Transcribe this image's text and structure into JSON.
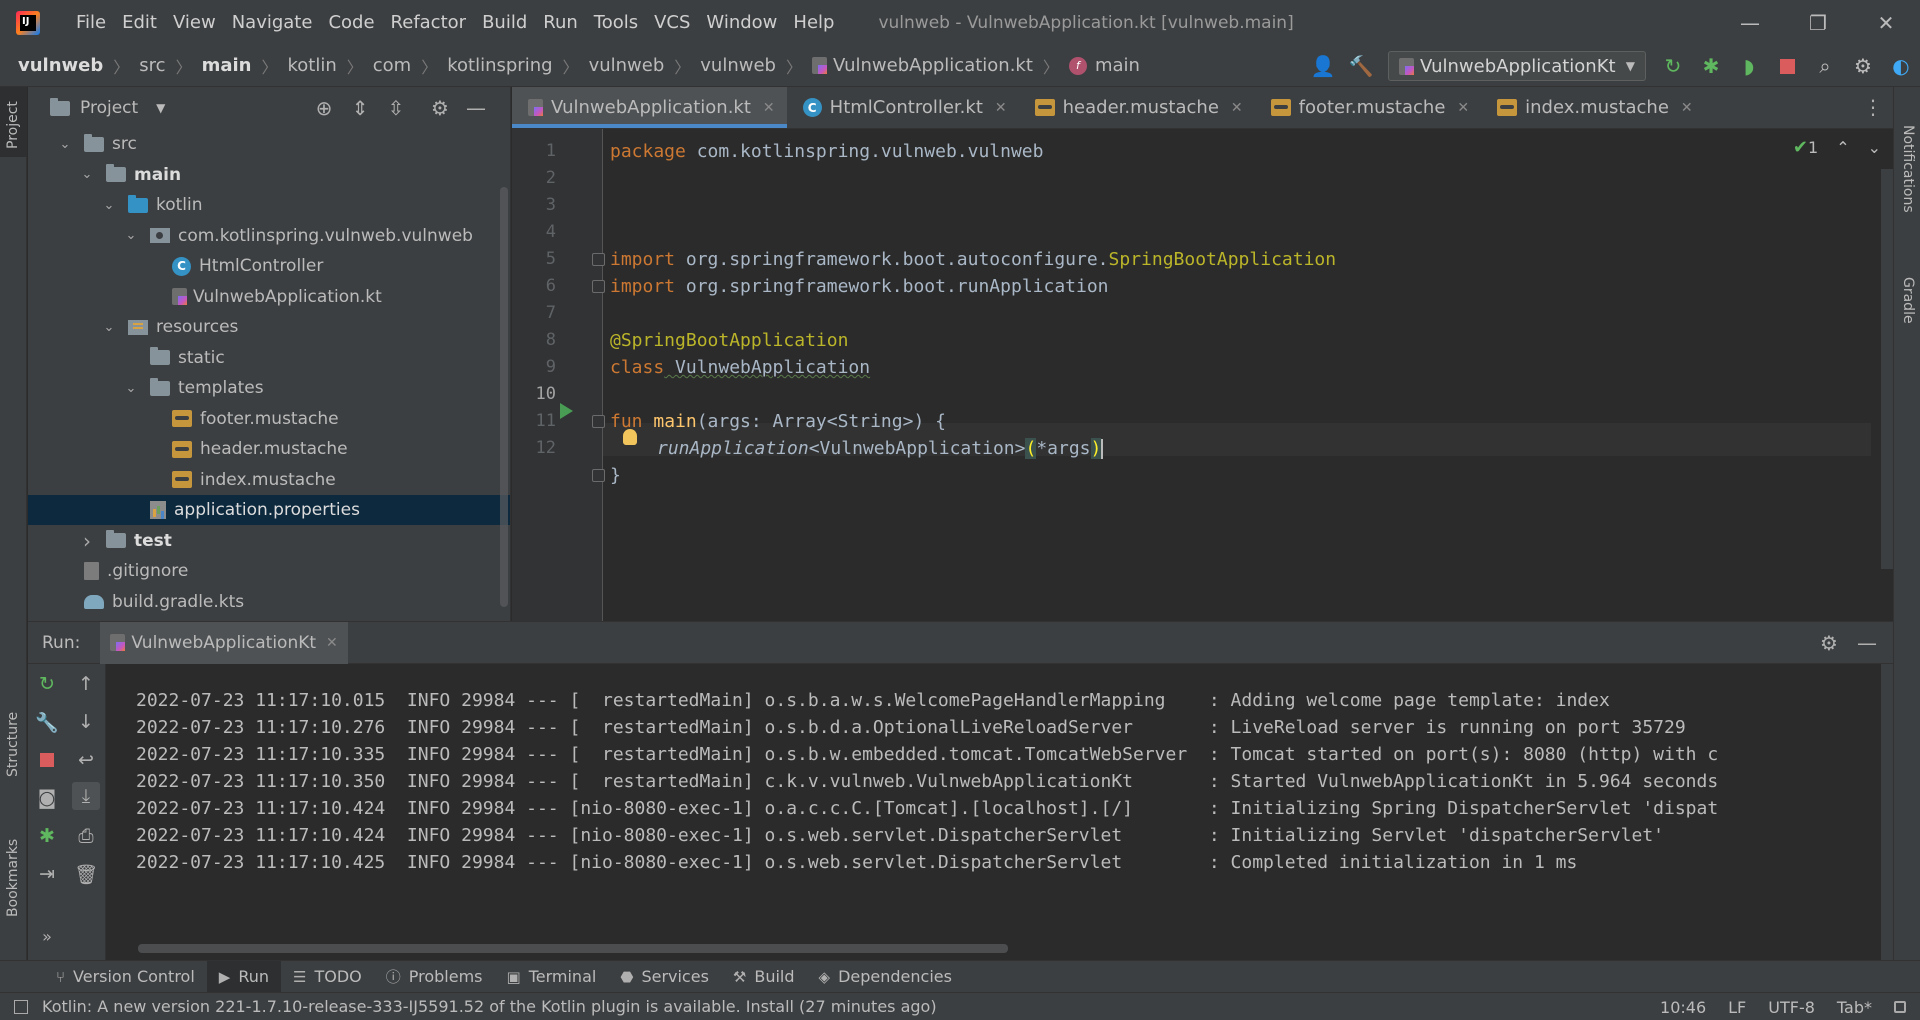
{
  "menu": [
    "File",
    "Edit",
    "View",
    "Navigate",
    "Code",
    "Refactor",
    "Build",
    "Run",
    "Tools",
    "VCS",
    "Window",
    "Help"
  ],
  "window_title": "vulnweb - VulnwebApplication.kt [vulnweb.main]",
  "window_controls": {
    "minimize": "—",
    "restore": "❐",
    "close": "✕"
  },
  "breadcrumbs": [
    "vulnweb",
    "src",
    "main",
    "kotlin",
    "com",
    "kotlinspring",
    "vulnweb",
    "vulnweb",
    "VulnwebApplication.kt",
    "main"
  ],
  "run_config": "VulnwebApplicationKt",
  "project_panel": {
    "title": "Project",
    "tree": [
      {
        "label": "src",
        "indent": 1,
        "chev": "v",
        "icon": "folder"
      },
      {
        "label": "main",
        "indent": 2,
        "chev": "v",
        "icon": "folder",
        "bold": true
      },
      {
        "label": "kotlin",
        "indent": 3,
        "chev": "v",
        "icon": "folder-blue"
      },
      {
        "label": "com.kotlinspring.vulnweb.vulnweb",
        "indent": 4,
        "chev": "v",
        "icon": "package"
      },
      {
        "label": "HtmlController",
        "indent": 5,
        "chev": "",
        "icon": "class"
      },
      {
        "label": "VulnwebApplication.kt",
        "indent": 5,
        "chev": "",
        "icon": "kotlin-file"
      },
      {
        "label": "resources",
        "indent": 3,
        "chev": "v",
        "icon": "resources"
      },
      {
        "label": "static",
        "indent": 4,
        "chev": "",
        "icon": "folder"
      },
      {
        "label": "templates",
        "indent": 4,
        "chev": "v",
        "icon": "folder"
      },
      {
        "label": "footer.mustache",
        "indent": 5,
        "chev": "",
        "icon": "mustache"
      },
      {
        "label": "header.mustache",
        "indent": 5,
        "chev": "",
        "icon": "mustache"
      },
      {
        "label": "index.mustache",
        "indent": 5,
        "chev": "",
        "icon": "mustache"
      },
      {
        "label": "application.properties",
        "indent": 4,
        "chev": "",
        "icon": "properties",
        "selected": true
      },
      {
        "label": "test",
        "indent": 2,
        "chev": ">",
        "icon": "folder",
        "bold": true
      },
      {
        "label": ".gitignore",
        "indent": 1,
        "chev": "",
        "icon": "git"
      },
      {
        "label": "build.gradle.kts",
        "indent": 1,
        "chev": "",
        "icon": "gradle"
      }
    ]
  },
  "editor_tabs": [
    {
      "label": "VulnwebApplication.kt",
      "icon": "kotlin-file",
      "active": true
    },
    {
      "label": "HtmlController.kt",
      "icon": "class"
    },
    {
      "label": "header.mustache",
      "icon": "mustache"
    },
    {
      "label": "footer.mustache",
      "icon": "mustache"
    },
    {
      "label": "index.mustache",
      "icon": "mustache"
    }
  ],
  "line_numbers": [
    "1",
    "2",
    "3",
    "4",
    "5",
    "6",
    "7",
    "8",
    "9",
    "10",
    "11",
    "12"
  ],
  "code": {
    "l1_kw": "package",
    "l1_rest": " com.kotlinspring.vulnweb.vulnweb",
    "l3_kw": "import",
    "l3_rest": " org.springframework.boot.autoconfigure.",
    "l3_ann": "SpringBootApplication",
    "l4_kw": "import",
    "l4_rest": " org.springframework.boot.runApplication",
    "l6_ann": "@SpringBootApplication",
    "l7_kw": "class",
    "l7_rest": " VulnwebApplication",
    "l9_kw": "fun",
    "l9_fn": " main",
    "l9_rest": "(args: Array<String>) {",
    "l10_fn": "runApplication",
    "l10_rest": "<VulnwebApplication>",
    "l10_open": "(",
    "l10_arg": "*args",
    "l10_close": ")",
    "l11": "}"
  },
  "inspection_count": "1",
  "run_panel": {
    "label": "Run:",
    "tab": "VulnwebApplicationKt",
    "log_lines": [
      "2022-07-23 11:17:10.015  INFO 29984 --- [  restartedMain] o.s.b.a.w.s.WelcomePageHandlerMapping    : Adding welcome page template: index",
      "2022-07-23 11:17:10.276  INFO 29984 --- [  restartedMain] o.s.b.d.a.OptionalLiveReloadServer       : LiveReload server is running on port 35729",
      "2022-07-23 11:17:10.335  INFO 29984 --- [  restartedMain] o.s.b.w.embedded.tomcat.TomcatWebServer  : Tomcat started on port(s): 8080 (http) with c",
      "2022-07-23 11:17:10.350  INFO 29984 --- [  restartedMain] c.k.v.vulnweb.VulnwebApplicationKt       : Started VulnwebApplicationKt in 5.964 seconds",
      "2022-07-23 11:17:10.424  INFO 29984 --- [nio-8080-exec-1] o.a.c.c.C.[Tomcat].[localhost].[/]       : Initializing Spring DispatcherServlet 'dispat",
      "2022-07-23 11:17:10.424  INFO 29984 --- [nio-8080-exec-1] o.s.web.servlet.DispatcherServlet        : Initializing Servlet 'dispatcherServlet'",
      "2022-07-23 11:17:10.425  INFO 29984 --- [nio-8080-exec-1] o.s.web.servlet.DispatcherServlet        : Completed initialization in 1 ms"
    ]
  },
  "left_stripe": {
    "project": "Project",
    "structure": "Structure",
    "bookmarks": "Bookmarks"
  },
  "right_stripe": {
    "notifications": "Notifications",
    "gradle": "Gradle"
  },
  "bottom_tools": [
    "Version Control",
    "Run",
    "TODO",
    "Problems",
    "Terminal",
    "Services",
    "Build",
    "Dependencies"
  ],
  "status": {
    "message": "Kotlin: A new version 221-1.7.10-release-333-IJ5591.52 of the Kotlin plugin is available. Install (27 minutes ago)",
    "position": "10:46",
    "line_sep": "LF",
    "encoding": "UTF-8",
    "indent": "Tab*"
  },
  "colors": {
    "bg": "#2b2b2b",
    "panel": "#3c3f41",
    "accent": "#4a88c7",
    "keyword": "#cc7832",
    "annotation": "#bbb529",
    "function": "#ffc66d"
  }
}
